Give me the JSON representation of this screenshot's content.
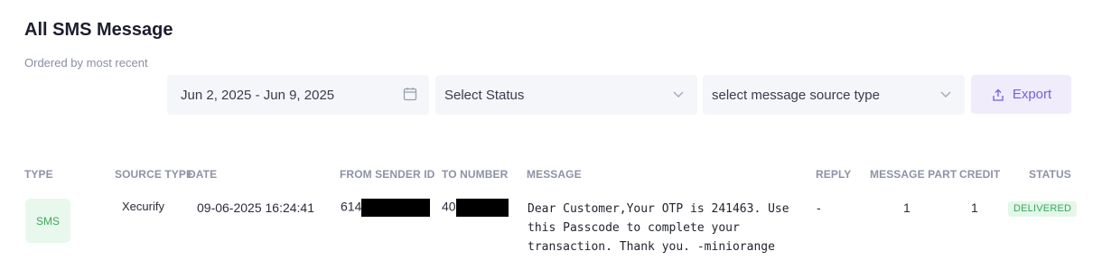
{
  "page": {
    "title": "All SMS Message",
    "subtitle": "Ordered by most recent"
  },
  "filters": {
    "date_range": "Jun 2, 2025 - Jun 9, 2025",
    "status_placeholder": "Select Status",
    "source_placeholder": "select message source type",
    "export_label": "Export"
  },
  "table": {
    "headers": {
      "type": "TYPE",
      "source_type": "SOURCE TYPE",
      "date": "DATE",
      "from_sender_id": "FROM SENDER ID",
      "to_number": "TO NUMBER",
      "message": "MESSAGE",
      "reply": "REPLY",
      "message_part": "MESSAGE PART",
      "credit": "CREDIT",
      "status": "STATUS"
    },
    "rows": [
      {
        "type": "SMS",
        "source_type": "Xecurify",
        "date": "09-06-2025 16:24:41",
        "from_sender_id_prefix": "614",
        "to_number_prefix": "40",
        "message": "Dear Customer,Your OTP is 241463. Use this Passcode to complete your transaction. Thank you. -miniorange",
        "reply": "-",
        "message_part": "1",
        "credit": "1",
        "status": "DELIVERED"
      }
    ]
  },
  "colors": {
    "accent": "#7a5ce0",
    "success": "#37a85a",
    "filter_bg": "#f4f6f9"
  },
  "icons": {
    "calendar": "calendar-icon",
    "chevron": "chevron-down-icon",
    "export": "upload-icon"
  }
}
